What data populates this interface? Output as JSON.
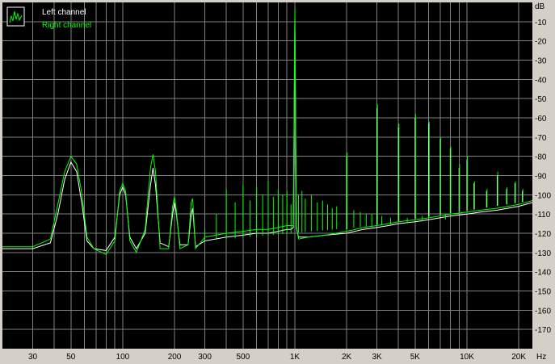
{
  "chart_data": {
    "type": "line",
    "title": "",
    "xlabel": "Hz",
    "ylabel": "dB",
    "x_scale": "log",
    "xlim": [
      20,
      24000
    ],
    "ylim": [
      -180,
      0
    ],
    "grid": true,
    "legend_placement": "top-left",
    "colors": {
      "background": "#000000",
      "grid": "#808080",
      "left": "#ffffff",
      "right": "#00ff00",
      "frame": "#d4d0c8"
    },
    "x_ticks": [
      {
        "value": 30,
        "label": "30"
      },
      {
        "value": 50,
        "label": "50"
      },
      {
        "value": 100,
        "label": "100"
      },
      {
        "value": 200,
        "label": "200"
      },
      {
        "value": 300,
        "label": "300"
      },
      {
        "value": 500,
        "label": "500"
      },
      {
        "value": 1000,
        "label": "1K"
      },
      {
        "value": 2000,
        "label": "2K"
      },
      {
        "value": 3000,
        "label": "3K"
      },
      {
        "value": 5000,
        "label": "5K"
      },
      {
        "value": 10000,
        "label": "10K"
      },
      {
        "value": 20000,
        "label": "20K"
      }
    ],
    "y_ticks": [
      -10,
      -20,
      -30,
      -40,
      -50,
      -60,
      -70,
      -80,
      -90,
      -100,
      -110,
      -120,
      -130,
      -140,
      -150,
      -160,
      -170
    ],
    "y_unit_label": "dB",
    "x_unit_label": "Hz",
    "legend_icon": "spectrum-icon",
    "series": [
      {
        "name": "Left channel",
        "color": "#ffffff",
        "x": [
          20,
          30,
          38,
          42,
          46,
          50,
          54,
          58,
          62,
          68,
          80,
          90,
          96,
          100,
          104,
          110,
          120,
          135,
          145,
          150,
          155,
          165,
          185,
          195,
          200,
          205,
          215,
          240,
          250,
          255,
          265,
          300,
          400,
          500,
          600,
          700,
          800,
          900,
          950,
          980,
          1000,
          1020,
          1050,
          1200,
          1500,
          2000,
          2500,
          3000,
          3500,
          4000,
          5000,
          6000,
          8000,
          10000,
          12000,
          15000,
          20000,
          24000
        ],
        "y": [
          -128,
          -128,
          -125,
          -110,
          -92,
          -83,
          -88,
          -105,
          -124,
          -128,
          -129,
          -122,
          -100,
          -96,
          -100,
          -122,
          -128,
          -120,
          -95,
          -86,
          -95,
          -125,
          -127,
          -110,
          -104,
          -110,
          -126,
          -126,
          -110,
          -107,
          -127,
          -124,
          -122,
          -121,
          -120,
          -120,
          -119,
          -118,
          -118,
          -117,
          -8,
          -117,
          -122,
          -122,
          -121,
          -120,
          -118,
          -117,
          -116,
          -115,
          -114,
          -113,
          -111,
          -110,
          -109,
          -108,
          -106,
          -104
        ]
      },
      {
        "name": "Right channel",
        "color": "#00ff00",
        "x": [
          20,
          30,
          38,
          42,
          46,
          50,
          54,
          58,
          62,
          68,
          80,
          90,
          96,
          100,
          104,
          110,
          120,
          135,
          145,
          150,
          155,
          165,
          185,
          195,
          200,
          205,
          215,
          240,
          250,
          255,
          265,
          300,
          400,
          500,
          600,
          700,
          800,
          900,
          950,
          980,
          1000,
          1020,
          1050,
          1200,
          1500,
          2000,
          2500,
          3000,
          3500,
          4000,
          5000,
          6000,
          8000,
          10000,
          12000,
          15000,
          20000,
          24000
        ],
        "y": [
          -127,
          -127,
          -123,
          -105,
          -88,
          -80,
          -84,
          -100,
          -122,
          -128,
          -131,
          -124,
          -98,
          -94,
          -98,
          -124,
          -130,
          -118,
          -86,
          -79,
          -88,
          -128,
          -128,
          -106,
          -101,
          -108,
          -128,
          -126,
          -104,
          -102,
          -128,
          -122,
          -120,
          -119,
          -118,
          -118,
          -117,
          -116,
          -116,
          -116,
          -3,
          -116,
          -123,
          -122,
          -121,
          -119,
          -117,
          -116,
          -115,
          -114,
          -113,
          -112,
          -110,
          -109,
          -108,
          -107,
          -105,
          -103
        ]
      }
    ],
    "harmonic_peaks": [
      {
        "x": 2000,
        "left": -80,
        "right": -78
      },
      {
        "x": 3000,
        "left": -55,
        "right": -53
      },
      {
        "x": 4000,
        "left": -65,
        "right": -63
      },
      {
        "x": 5000,
        "left": -60,
        "right": -58
      },
      {
        "x": 6000,
        "left": -63,
        "right": -62
      },
      {
        "x": 7000,
        "left": -71,
        "right": -70
      },
      {
        "x": 8000,
        "left": -76,
        "right": -75
      },
      {
        "x": 9000,
        "left": -86,
        "right": -84
      },
      {
        "x": 10000,
        "left": -82,
        "right": -80
      },
      {
        "x": 11000,
        "left": -94,
        "right": -93
      },
      {
        "x": 13000,
        "left": -98,
        "right": -97
      },
      {
        "x": 15000,
        "left": -90,
        "right": -88
      },
      {
        "x": 17000,
        "left": -97,
        "right": -96
      },
      {
        "x": 19000,
        "left": -94,
        "right": -93
      },
      {
        "x": 21000,
        "left": -98,
        "right": -97
      }
    ],
    "hum_spurs": [
      {
        "x": 300,
        "level": -118
      },
      {
        "x": 350,
        "level": -110
      },
      {
        "x": 400,
        "level": -97
      },
      {
        "x": 450,
        "level": -104
      },
      {
        "x": 500,
        "level": -95
      },
      {
        "x": 550,
        "level": -103
      },
      {
        "x": 600,
        "level": -96
      },
      {
        "x": 650,
        "level": -100
      },
      {
        "x": 700,
        "level": -93
      },
      {
        "x": 750,
        "level": -101
      },
      {
        "x": 800,
        "level": -97
      },
      {
        "x": 850,
        "level": -100
      },
      {
        "x": 900,
        "level": -98
      },
      {
        "x": 950,
        "level": -105
      },
      {
        "x": 1050,
        "level": -100
      },
      {
        "x": 1100,
        "level": -98
      },
      {
        "x": 1150,
        "level": -102
      },
      {
        "x": 1250,
        "level": -100
      },
      {
        "x": 1350,
        "level": -104
      },
      {
        "x": 1450,
        "level": -103
      },
      {
        "x": 1550,
        "level": -105
      },
      {
        "x": 1650,
        "level": -107
      },
      {
        "x": 1750,
        "level": -106
      },
      {
        "x": 2200,
        "level": -108
      },
      {
        "x": 2400,
        "level": -109
      },
      {
        "x": 2600,
        "level": -110
      },
      {
        "x": 2800,
        "level": -110
      },
      {
        "x": 3200,
        "level": -111
      },
      {
        "x": 3600,
        "level": -112
      },
      {
        "x": 4500,
        "level": -112
      },
      {
        "x": 5500,
        "level": -111
      },
      {
        "x": 7500,
        "level": -110
      }
    ]
  }
}
